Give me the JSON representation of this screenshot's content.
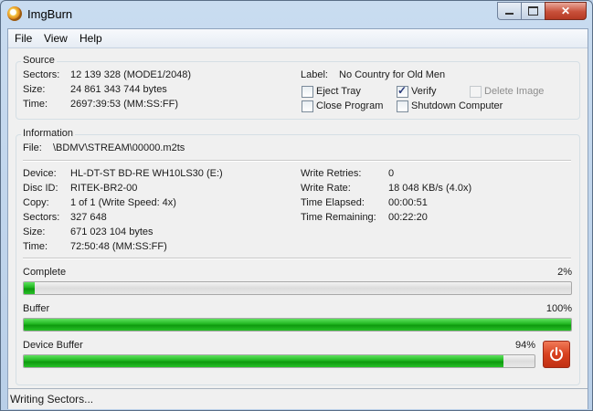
{
  "window": {
    "title": "ImgBurn"
  },
  "menu": [
    "File",
    "View",
    "Help"
  ],
  "source": {
    "legend": "Source",
    "sectors_label": "Sectors:",
    "sectors": "12 139 328 (MODE1/2048)",
    "size_label": "Size:",
    "size": "24 861 343 744 bytes",
    "time_label": "Time:",
    "time": "2697:39:53 (MM:SS:FF)",
    "disc_label_label": "Label:",
    "disc_label": "No Country for Old Men",
    "options": {
      "eject_tray": {
        "label": "Eject Tray",
        "checked": false,
        "enabled": true
      },
      "verify": {
        "label": "Verify",
        "checked": true,
        "enabled": true
      },
      "delete_image": {
        "label": "Delete Image",
        "checked": false,
        "enabled": false
      },
      "close_program": {
        "label": "Close Program",
        "checked": false,
        "enabled": true
      },
      "shutdown_computer": {
        "label": "Shutdown Computer",
        "checked": false,
        "enabled": true
      }
    }
  },
  "information": {
    "legend": "Information",
    "file_label": "File:",
    "file": "\\BDMV\\STREAM\\00000.m2ts",
    "device_label": "Device:",
    "device": "HL-DT-ST BD-RE WH10LS30 (E:)",
    "disc_id_label": "Disc ID:",
    "disc_id": "RITEK-BR2-00",
    "copy_label": "Copy:",
    "copy": "1 of 1 (Write Speed: 4x)",
    "sectors_label": "Sectors:",
    "sectors": "327 648",
    "size_label": "Size:",
    "size": "671 023 104 bytes",
    "time_label": "Time:",
    "time": "72:50:48 (MM:SS:FF)",
    "write_retries_label": "Write Retries:",
    "write_retries": "0",
    "write_rate_label": "Write Rate:",
    "write_rate": "18 048 KB/s (4.0x)",
    "time_elapsed_label": "Time Elapsed:",
    "time_elapsed": "00:00:51",
    "time_remaining_label": "Time Remaining:",
    "time_remaining": "00:22:20"
  },
  "progress": {
    "complete": {
      "label": "Complete",
      "percent_text": "2%",
      "value": 0.02
    },
    "buffer": {
      "label": "Buffer",
      "percent_text": "100%",
      "value": 1.0
    },
    "device_buffer": {
      "label": "Device Buffer",
      "percent_text": "94%",
      "value": 0.94
    }
  },
  "colors": {
    "progress_green": "#1fb51f",
    "abort_red": "#d8411f"
  },
  "icons": {
    "app": "imgburn-disc-icon",
    "abort": "power-icon"
  },
  "status": "Writing Sectors..."
}
